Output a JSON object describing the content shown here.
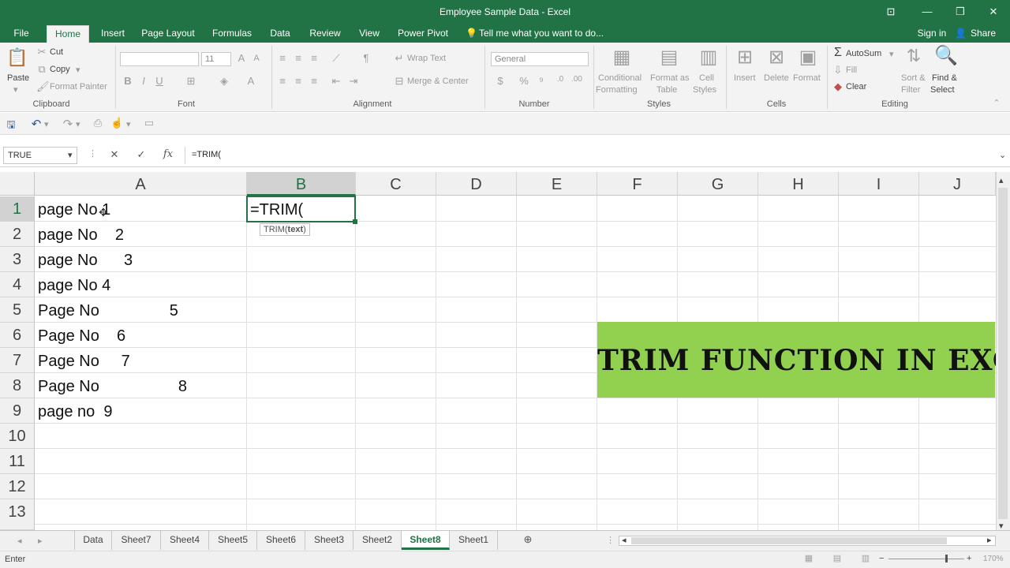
{
  "title": "Employee Sample Data - Excel",
  "tabs": [
    "File",
    "Home",
    "Insert",
    "Page Layout",
    "Formulas",
    "Data",
    "Review",
    "View",
    "Power Pivot"
  ],
  "tell_me": "Tell me what you want to do...",
  "sign_in": "Sign in",
  "share": "Share",
  "ribbon": {
    "clipboard": {
      "label": "Clipboard",
      "paste": "Paste",
      "cut": "Cut",
      "copy": "Copy",
      "format_painter": "Format Painter"
    },
    "font": {
      "label": "Font",
      "size": "11"
    },
    "alignment": {
      "label": "Alignment",
      "wrap_text": "Wrap Text",
      "merge_center": "Merge & Center"
    },
    "number": {
      "label": "Number",
      "format": "General"
    },
    "styles": {
      "label": "Styles",
      "conditional": "Conditional",
      "formatting": "Formatting",
      "format_as": "Format as",
      "table": "Table",
      "cell": "Cell",
      "styles_btn": "Styles"
    },
    "cells": {
      "label": "Cells",
      "insert": "Insert",
      "delete": "Delete",
      "format": "Format"
    },
    "editing": {
      "label": "Editing",
      "autosum": "AutoSum",
      "fill": "Fill",
      "clear": "Clear",
      "sort": "Sort &",
      "filter": "Filter",
      "find": "Find &",
      "select": "Select"
    }
  },
  "name_box": "TRUE",
  "formula": "=TRIM(",
  "columns": [
    "A",
    "B",
    "C",
    "D",
    "E",
    "F",
    "G",
    "H",
    "I",
    "J"
  ],
  "rows": [
    "1",
    "2",
    "3",
    "4",
    "5",
    "6",
    "7",
    "8",
    "9",
    "10",
    "11",
    "12",
    "13"
  ],
  "cellsA": [
    "page No 1",
    "page No    2",
    "page No      3",
    "page No 4",
    "Page No                5",
    "Page No    6",
    "Page No     7",
    "Page No                  8",
    "page no  9"
  ],
  "active_cell_text": "=TRIM(",
  "tooltip_fn": "TRIM(",
  "tooltip_arg": "text",
  "tooltip_close": ")",
  "banner": "TRIM FUNCTION IN EXCEL",
  "sheets": [
    "Data",
    "Sheet7",
    "Sheet4",
    "Sheet5",
    "Sheet6",
    "Sheet3",
    "Sheet2",
    "Sheet8",
    "Sheet1"
  ],
  "active_sheet": "Sheet8",
  "status": "Enter",
  "zoom": "170%",
  "colors": {
    "accent": "#217346",
    "banner": "#92d050"
  }
}
